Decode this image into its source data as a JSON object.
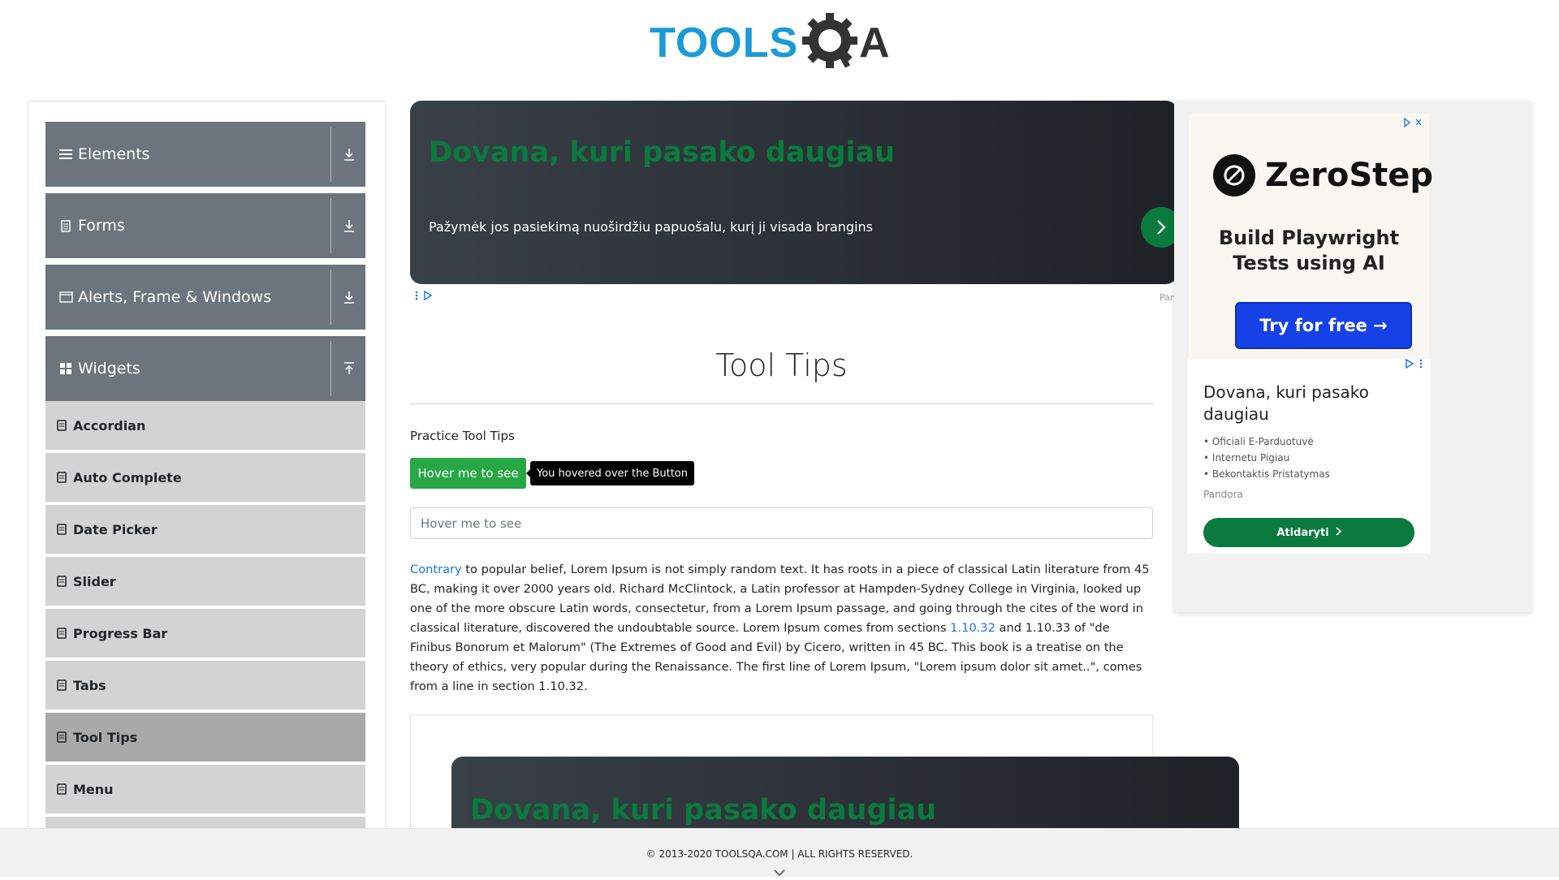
{
  "header": {
    "logo_text_left": "TOOLS",
    "logo_text_right": "QA",
    "colors": {
      "logo_blue": "#1a9ad6",
      "logo_dark": "#333333"
    }
  },
  "sidebar": {
    "groups": [
      {
        "label": "Elements",
        "icon": "list-icon",
        "arrow": "download-icon"
      },
      {
        "label": "Forms",
        "icon": "document-icon",
        "arrow": "download-icon"
      },
      {
        "label": "Alerts, Frame & Windows",
        "icon": "window-icon",
        "arrow": "download-icon"
      },
      {
        "label": "Widgets",
        "icon": "grid-icon",
        "arrow": "upload-icon"
      }
    ],
    "items": [
      {
        "label": "Accordian",
        "active": false
      },
      {
        "label": "Auto Complete",
        "active": false
      },
      {
        "label": "Date Picker",
        "active": false
      },
      {
        "label": "Slider",
        "active": false
      },
      {
        "label": "Progress Bar",
        "active": false
      },
      {
        "label": "Tabs",
        "active": false
      },
      {
        "label": "Tool Tips",
        "active": true
      },
      {
        "label": "Menu",
        "active": false
      }
    ]
  },
  "ad_top": {
    "title": "Dovana, kuri pasako daugiau",
    "description": "Pažymėk jos pasiekimą nuoširdžiu papuošalu, kurį ji visada brangins",
    "truncated_label": "Pan"
  },
  "main": {
    "page_title": "Tool Tips",
    "practice_label": "Practice Tool Tips",
    "button_label": "Hover me to see",
    "tooltip_text": "You hovered over the Button",
    "input_placeholder": "Hover me to see",
    "paragraph": {
      "link1": "Contrary",
      "text1": " to popular belief, Lorem Ipsum is not simply random text. It has roots in a piece of classical Latin literature from 45 BC, making it over 2000 years old. Richard McClintock, a Latin professor at Hampden-Sydney College in Virginia, looked up one of the more obscure Latin words, consectetur, from a Lorem Ipsum passage, and going through the cites of the word in classical literature, discovered the undoubtable source. Lorem Ipsum comes from sections ",
      "link2": "1.10.32",
      "text2": " and 1.10.33 of \"de Finibus Bonorum et Malorum\" (The Extremes of Good and Evil) by Cicero, written in 45 BC. This book is a treatise on the theory of ethics, very popular during the Renaissance. The first line of Lorem Ipsum, \"Lorem ipsum dolor sit amet..\", comes from a line in section 1.10.32."
    }
  },
  "ad_bottom": {
    "title": "Dovana, kuri pasako daugiau"
  },
  "right_ad": {
    "zerostep": {
      "brand": "ZeroStep",
      "tagline_line1": "Build Playwright",
      "tagline_line2": "Tests using AI",
      "button": "Try for free →"
    },
    "dovana": {
      "title": "Dovana, kuri pasako daugiau",
      "bullets": [
        "Oficiali E-Parduotuvė",
        "Internetu Pigiau",
        "Bekontaktis Pristatymas"
      ],
      "brand": "Pandora",
      "button": "Atidaryti"
    }
  },
  "footer": {
    "text": "© 2013-2020 TOOLSQA.COM | ALL RIGHTS RESERVED."
  },
  "colors": {
    "sidebar_header": "#6c757d",
    "sidebar_item": "#d3d3d3",
    "sidebar_item_active": "#a9a9a9",
    "button_green": "#28a745",
    "ad_green": "#0a7a3e",
    "zerostep_blue": "#1641e6"
  }
}
